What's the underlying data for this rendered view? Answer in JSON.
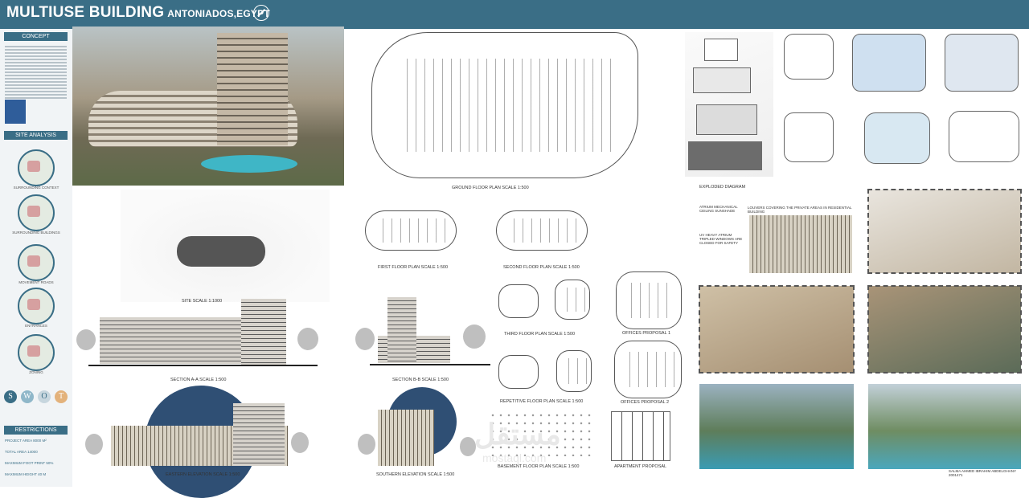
{
  "header": {
    "title": "MULTIUSE BUILDING",
    "subtitle": "ANTONIADOS,EGYPT"
  },
  "sidebar": {
    "concept_heading": "CONCEPT",
    "site_analysis_heading": "SITE ANALYSIS",
    "site_analysis_captions": [
      "SURROUNDING CONTEXT",
      "SURROUNDING BUILDINGS",
      "MOVEMENT ROADS",
      "ENTRANCES",
      "ZONING"
    ],
    "swot": [
      "S",
      "W",
      "O",
      "T"
    ],
    "swot_colors": [
      "#3a6e86",
      "#8fb7c9",
      "#c7d6de",
      "#e3b27b"
    ],
    "restrictions_heading": "RESTRICTIONS",
    "restrictions": [
      "PROJECT AREA 8000 M²",
      "TOTAL AREA 14000",
      "MAXIMUM FOOT PRINT 50%",
      "MAXIMUM HEIGHT 40 M"
    ]
  },
  "drawings": {
    "ground_floor": "GROUND FLOOR PLAN SCALE 1:500",
    "site": "SITE SCALE 1:1000",
    "first_floor": "FIRST FLOOR PLAN SCALE 1:500",
    "second_floor": "SECOND FLOOR PLAN SCALE 1:500",
    "third_floor": "THIRD FLOOR PLAN SCALE 1:500",
    "repetitive_floor": "REPETITIVE FLOOR PLAN SCALE 1:500",
    "basement": "BASEMENT FLOOR PLAN SCALE 1:500",
    "offices_1": "OFFICES PROPOSAL 1",
    "offices_2": "OFFICES PROPOSAL 2",
    "apartment": "APARTMENT PROPOSAL",
    "section_aa": "SECTION A-A SCALE 1:500",
    "section_bb": "SECTION B-B SCALE 1:500",
    "eastern_elev": "EASTERN ELEVATION SCALE 1:500",
    "southern_elev": "SOUTHERN ELEVATION SCALE 1:500",
    "exploded": "EXPLODED DIAGRAM"
  },
  "annotations": {
    "atrium": "ATRIUM MECHANICAL CEILING SUNSHADE",
    "louvers": "LOUVERS COVERING THE PRIVATE AREAS IN RESIDENTIAL BUILDING",
    "windows": "UV HEAVY ATRIUM TRIPLED WINDOWS ARE CLOSED FOR SAFETY"
  },
  "credit": "SALMA AHMED IBRAHIM ABDELGHANY 2001471",
  "watermark": "مستقل",
  "watermark_sub": "mostaql.com",
  "colors": {
    "brand": "#3a6e86",
    "dome": "#2f4f74",
    "water": "#3fb6c6"
  }
}
